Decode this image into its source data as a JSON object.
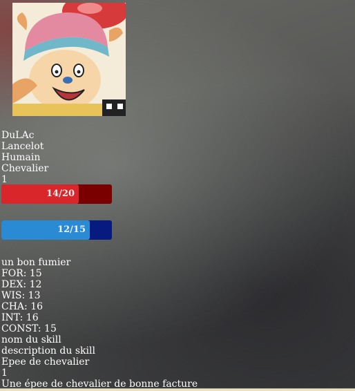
{
  "avatar": {
    "alt": "Chopper avatar"
  },
  "character": {
    "player": "DuLAc",
    "name": "Lancelot",
    "race": "Humain",
    "class": "Chevalier",
    "level": "1"
  },
  "hp": {
    "label": "14/20",
    "current": 14,
    "max": 20,
    "bar_color": "#d9262b",
    "track_color": "#7a0000"
  },
  "mp": {
    "label": "12/15",
    "current": 12,
    "max": 15,
    "bar_color": "#2a8ad4",
    "track_color": "#071a80"
  },
  "description": "un bon fumier",
  "stats": [
    "FOR: 15",
    "DEX: 12",
    "WIS: 13",
    "CHA: 16",
    "INT: 16",
    "CONST: 15"
  ],
  "skill": {
    "name": "nom du skill",
    "description": "description du skill"
  },
  "item": {
    "name": "Epee de chevalier",
    "quantity": "1",
    "description": "Une épee de chevalier de bonne facture"
  }
}
